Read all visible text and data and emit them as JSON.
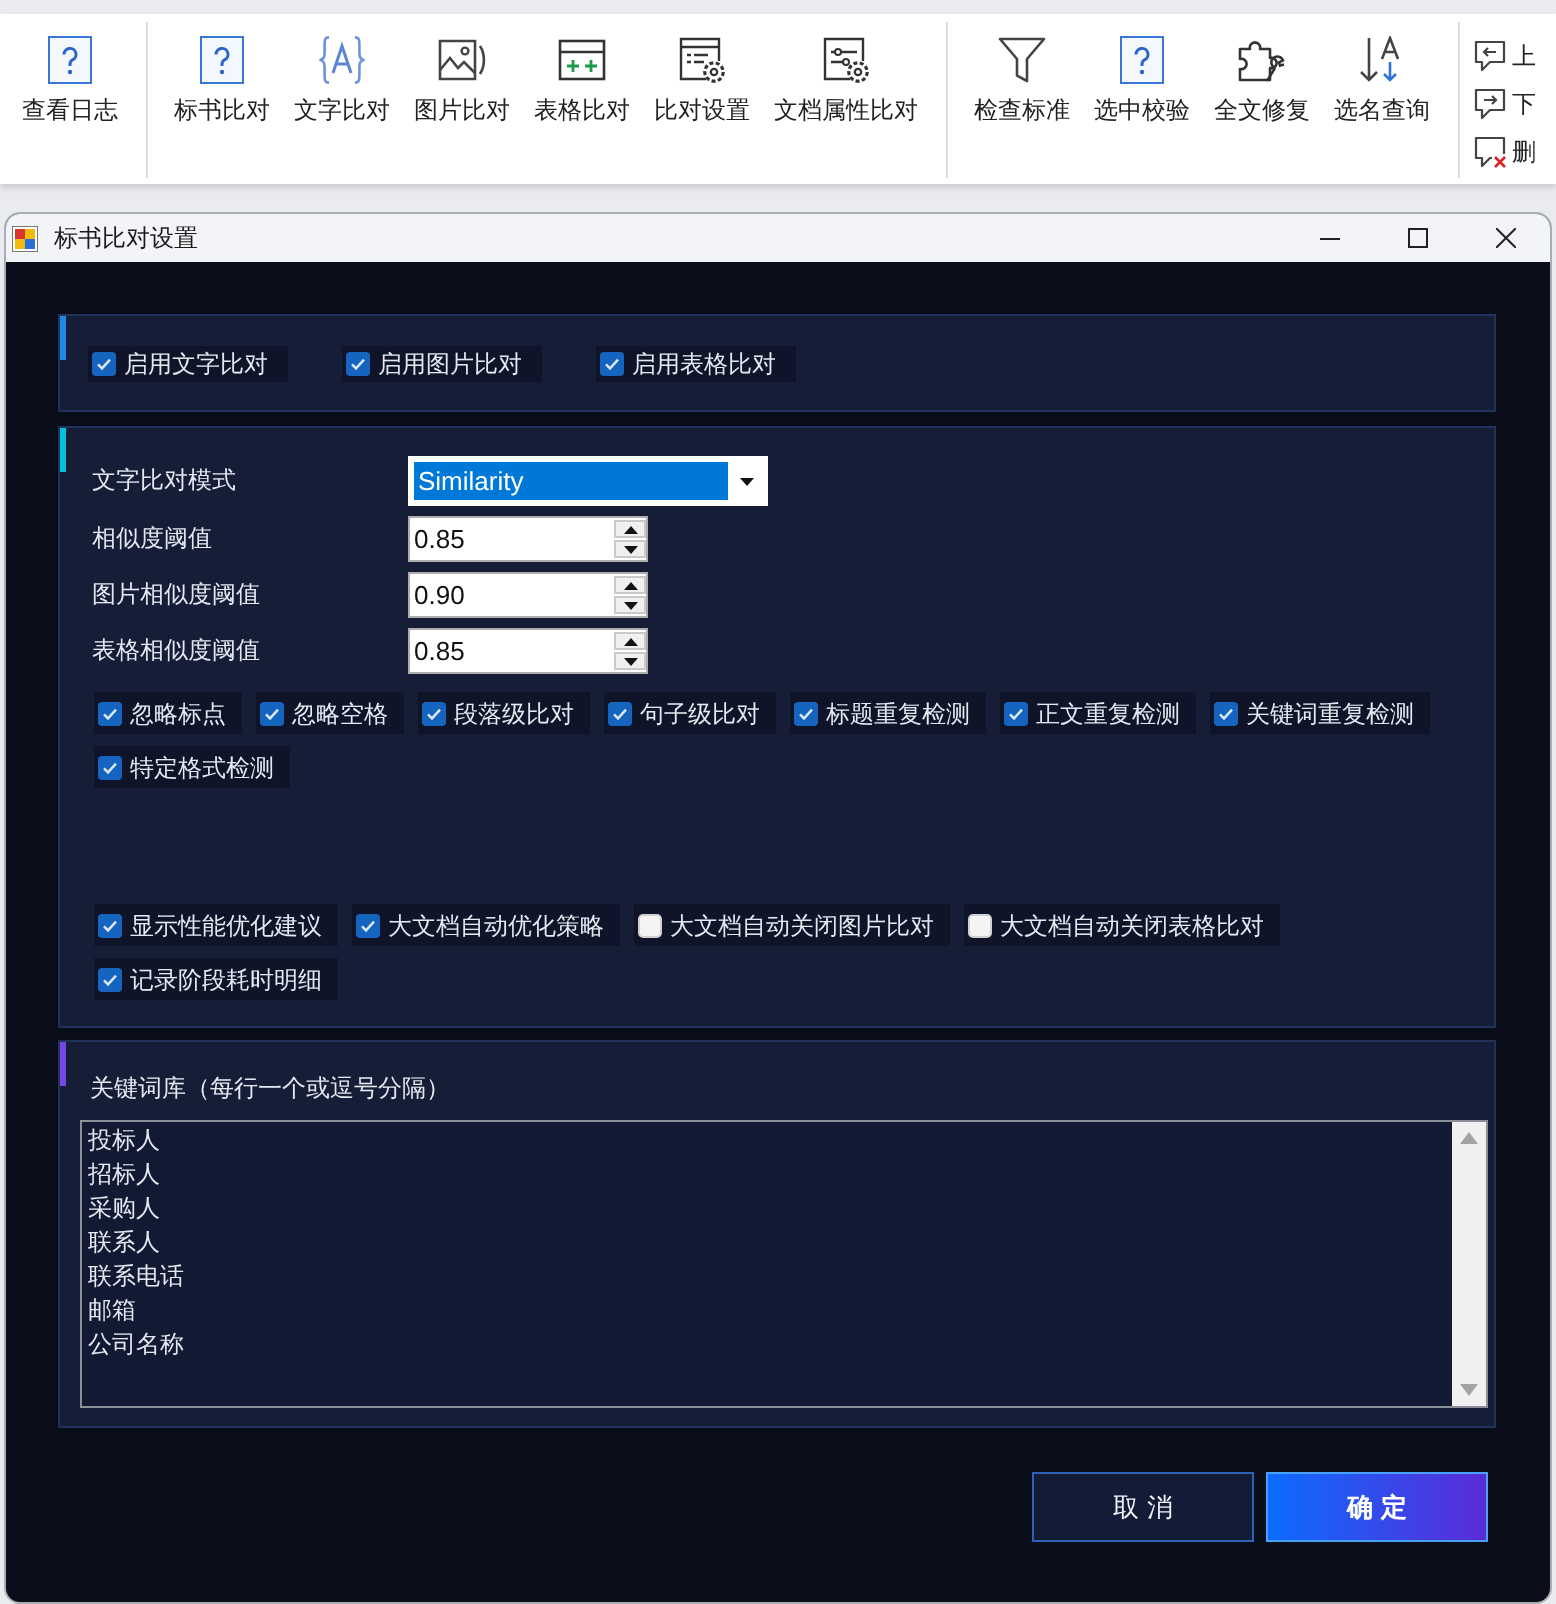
{
  "toolbar": {
    "groups": [
      {
        "items": [
          {
            "kind": "help",
            "label": "查看日志"
          }
        ]
      },
      {
        "items": [
          {
            "kind": "help",
            "label": "标书比对"
          },
          {
            "kind": "text",
            "label": "文字比对"
          },
          {
            "kind": "image",
            "label": "图片比对"
          },
          {
            "kind": "table",
            "label": "表格比对"
          },
          {
            "kind": "settings",
            "label": "比对设置"
          },
          {
            "kind": "properties",
            "label": "文档属性比对"
          }
        ]
      },
      {
        "items": [
          {
            "kind": "filter",
            "label": "检查标准"
          },
          {
            "kind": "help",
            "label": "选中校验"
          },
          {
            "kind": "repair",
            "label": "全文修复"
          },
          {
            "kind": "sort",
            "label": "选名查询"
          }
        ]
      }
    ],
    "side_items": [
      {
        "kind": "previous",
        "label": "上"
      },
      {
        "kind": "next",
        "label": "下"
      },
      {
        "kind": "delete",
        "label": "删"
      }
    ]
  },
  "dialog": {
    "title": "标书比对设置",
    "compare_types": [
      {
        "label": "启用文字比对",
        "checked": true
      },
      {
        "label": "启用图片比对",
        "checked": true
      },
      {
        "label": "启用表格比对",
        "checked": true
      }
    ],
    "fields": [
      {
        "kind": "dropdown",
        "label": "文字比对模式",
        "value": "Similarity",
        "highlighted": true
      },
      {
        "kind": "spinner",
        "label": "相似度阈值",
        "value": "0.85",
        "highlighted": false
      },
      {
        "kind": "spinner",
        "label": "图片相似度阈值",
        "value": "0.90",
        "highlighted": false
      },
      {
        "kind": "spinner",
        "label": "表格相似度阈值",
        "value": "0.85",
        "highlighted": false
      }
    ],
    "options": [
      {
        "label": "忽略标点",
        "checked": true
      },
      {
        "label": "忽略空格",
        "checked": true
      },
      {
        "label": "段落级比对",
        "checked": true
      },
      {
        "label": "句子级比对",
        "checked": true
      },
      {
        "label": "标题重复检测",
        "checked": true
      },
      {
        "label": "正文重复检测",
        "checked": true
      },
      {
        "label": "关键词重复检测",
        "checked": true
      },
      {
        "label": "特定格式检测",
        "checked": true
      }
    ],
    "performance": [
      {
        "label": "显示性能优化建议",
        "checked": true
      },
      {
        "label": "大文档自动优化策略",
        "checked": true
      },
      {
        "label": "大文档自动关闭图片比对",
        "checked": false
      },
      {
        "label": "大文档自动关闭表格比对",
        "checked": false
      },
      {
        "label": "记录阶段耗时明细",
        "checked": true
      }
    ],
    "keywords": {
      "label": "关键词库（每行一个或逗号分隔）",
      "lines": [
        "投标人",
        "招标人",
        "采购人",
        "联系人",
        "联系电话",
        "邮箱",
        "公司名称"
      ]
    },
    "buttons": [
      {
        "kind": "secondary",
        "label": "取 消"
      },
      {
        "kind": "primary",
        "label": "确 定"
      }
    ]
  }
}
